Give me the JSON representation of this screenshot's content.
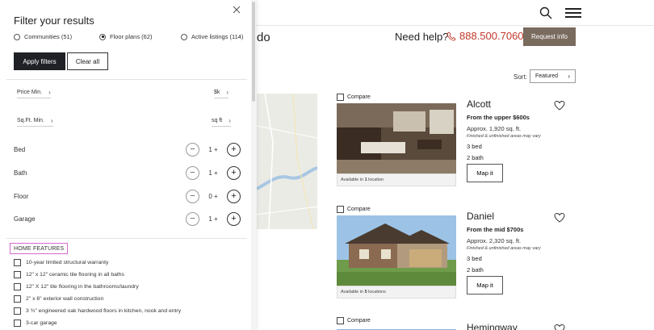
{
  "header": {
    "crumb_suffix": "do",
    "help_text": "Need help?",
    "phone": "888.500.7060",
    "request_label": "Request info"
  },
  "sort": {
    "label": "Sort:",
    "value": "Featured"
  },
  "listings": [
    {
      "compare_label": "Compare",
      "name": "Alcott",
      "price": "From the upper $600s",
      "sqft": "Approx. 1,920 sq. ft.",
      "note": "Finished & unfinished areas may vary",
      "beds": "3 bed",
      "baths": "2 bath",
      "map_label": "Map it",
      "avail_prefix": "Available in",
      "avail_count": "1",
      "avail_suffix": "location"
    },
    {
      "compare_label": "Compare",
      "name": "Daniel",
      "price": "From the mid $700s",
      "sqft": "Approx. 2,320 sq. ft.",
      "note": "Finished & unfinished areas may vary",
      "beds": "3 bed",
      "baths": "2 bath",
      "map_label": "Map it",
      "avail_prefix": "Available in",
      "avail_count": "5",
      "avail_suffix": "locations"
    },
    {
      "compare_label": "Compare",
      "name": "Hemingway"
    }
  ],
  "filter": {
    "title": "Filter your results",
    "tabs": [
      {
        "label": "Communities (51)",
        "selected": false
      },
      {
        "label": "Floor plans (62)",
        "selected": true
      },
      {
        "label": "Active listings (114)",
        "selected": false
      }
    ],
    "apply_label": "Apply filters",
    "clear_label": "Clear all",
    "price_min_label": "Price Min.",
    "price_unit": "$k",
    "sqft_min_label": "Sq.Ft. Min.",
    "sqft_unit": "sq ft",
    "steppers": [
      {
        "label": "Bed",
        "value": "1 +"
      },
      {
        "label": "Bath",
        "value": "1 +"
      },
      {
        "label": "Floor",
        "value": "0 +"
      },
      {
        "label": "Garage",
        "value": "1 +"
      }
    ],
    "features_heading": "HOME FEATURES",
    "features": [
      "10-year limited structural warranty",
      "12\" x 12\" ceramic tile flooring in all baths",
      "12\" X 12\" tile flooring in the bathrooms/laundry",
      "2\" x 6\" exterior wall construction",
      "3 ¾\" engineered oak hardwood floors in kitchen, nook and entry",
      "3-car garage"
    ]
  },
  "colors": {
    "accent_brown": "#7a6b5f",
    "phone_red": "#c0392b",
    "dark_button": "#1f2127",
    "highlight_border": "#d46bd0"
  }
}
